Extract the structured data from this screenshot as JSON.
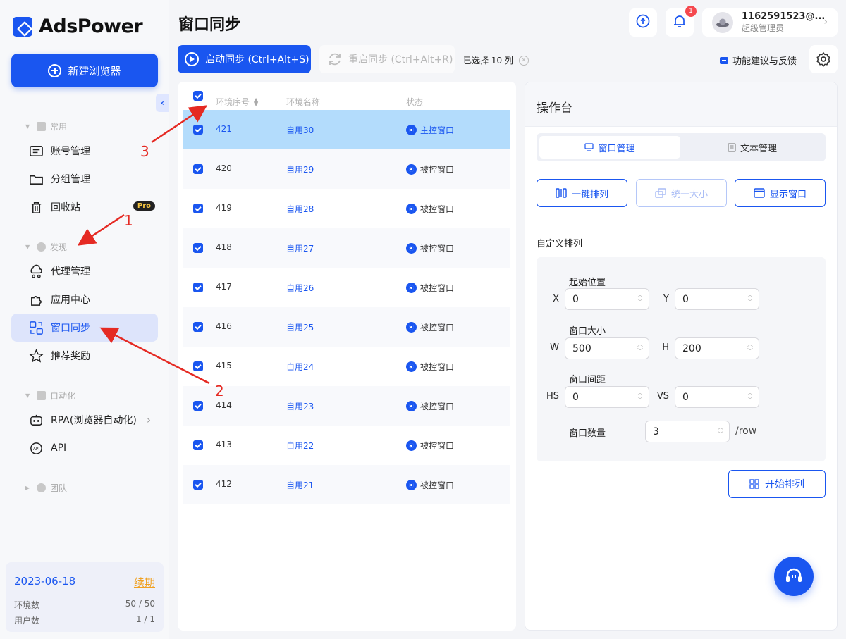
{
  "app": {
    "logo_text": "AdsPower",
    "brand_color": "#1a56f0"
  },
  "sidebar": {
    "new_browser_label": "新建浏览器",
    "sections": {
      "common": "常用",
      "discover": "发现",
      "automation": "自动化",
      "team": "团队"
    },
    "items": [
      {
        "label": "账号管理",
        "icon": "account-icon"
      },
      {
        "label": "分组管理",
        "icon": "folder-icon"
      },
      {
        "label": "回收站",
        "icon": "trash-icon",
        "badge": "Pro"
      },
      {
        "label": "代理管理",
        "icon": "proxy-icon"
      },
      {
        "label": "应用中心",
        "icon": "puzzle-icon"
      },
      {
        "label": "窗口同步",
        "icon": "window-sync-icon",
        "active": true
      },
      {
        "label": "推荐奖励",
        "icon": "star-icon"
      },
      {
        "label": "RPA(浏览器自动化)",
        "icon": "robot-icon"
      },
      {
        "label": "API",
        "icon": "api-icon"
      }
    ],
    "account": {
      "expiry": "2023-06-18",
      "renew_label": "续期",
      "env_label": "环境数",
      "env_value": "50 / 50",
      "user_label": "用户数",
      "user_value": "1 / 1"
    }
  },
  "header": {
    "title": "窗口同步",
    "notification_count": "1",
    "user_name": "1162591523@...",
    "user_role": "超级管理员"
  },
  "toolbar": {
    "start_sync_label": "启动同步 (Ctrl+Alt+S)",
    "restart_sync_label": "重启同步 (Ctrl+Alt+R)",
    "selected_info": "已选择 10 列",
    "feedback_label": "功能建议与反馈"
  },
  "table": {
    "columns": [
      "环境序号",
      "环境名称",
      "状态"
    ],
    "rows": [
      {
        "id": "421",
        "name": "自用30",
        "status": "主控窗口",
        "selected": true
      },
      {
        "id": "420",
        "name": "自用29",
        "status": "被控窗口"
      },
      {
        "id": "419",
        "name": "自用28",
        "status": "被控窗口"
      },
      {
        "id": "418",
        "name": "自用27",
        "status": "被控窗口"
      },
      {
        "id": "417",
        "name": "自用26",
        "status": "被控窗口"
      },
      {
        "id": "416",
        "name": "自用25",
        "status": "被控窗口"
      },
      {
        "id": "415",
        "name": "自用24",
        "status": "被控窗口"
      },
      {
        "id": "414",
        "name": "自用23",
        "status": "被控窗口"
      },
      {
        "id": "413",
        "name": "自用22",
        "status": "被控窗口"
      },
      {
        "id": "412",
        "name": "自用21",
        "status": "被控窗口"
      }
    ]
  },
  "console": {
    "title": "操作台",
    "tab_window": "窗口管理",
    "tab_text": "文本管理",
    "btn_arrange": "一键排列",
    "btn_resize": "统一大小",
    "btn_show": "显示窗口",
    "custom_title": "自定义排列",
    "start_pos_label": "起始位置",
    "x_label": "X",
    "x_value": "0",
    "y_label": "Y",
    "y_value": "0",
    "size_label": "窗口大小",
    "w_label": "W",
    "w_value": "500",
    "h_label": "H",
    "h_value": "200",
    "gap_label": "窗口间距",
    "hs_label": "HS",
    "hs_value": "0",
    "vs_label": "VS",
    "vs_value": "0",
    "count_label": "窗口数量",
    "count_value": "3",
    "count_unit": "/row",
    "start_arrange_label": "开始排列"
  },
  "annotations": [
    "1",
    "2",
    "3"
  ]
}
